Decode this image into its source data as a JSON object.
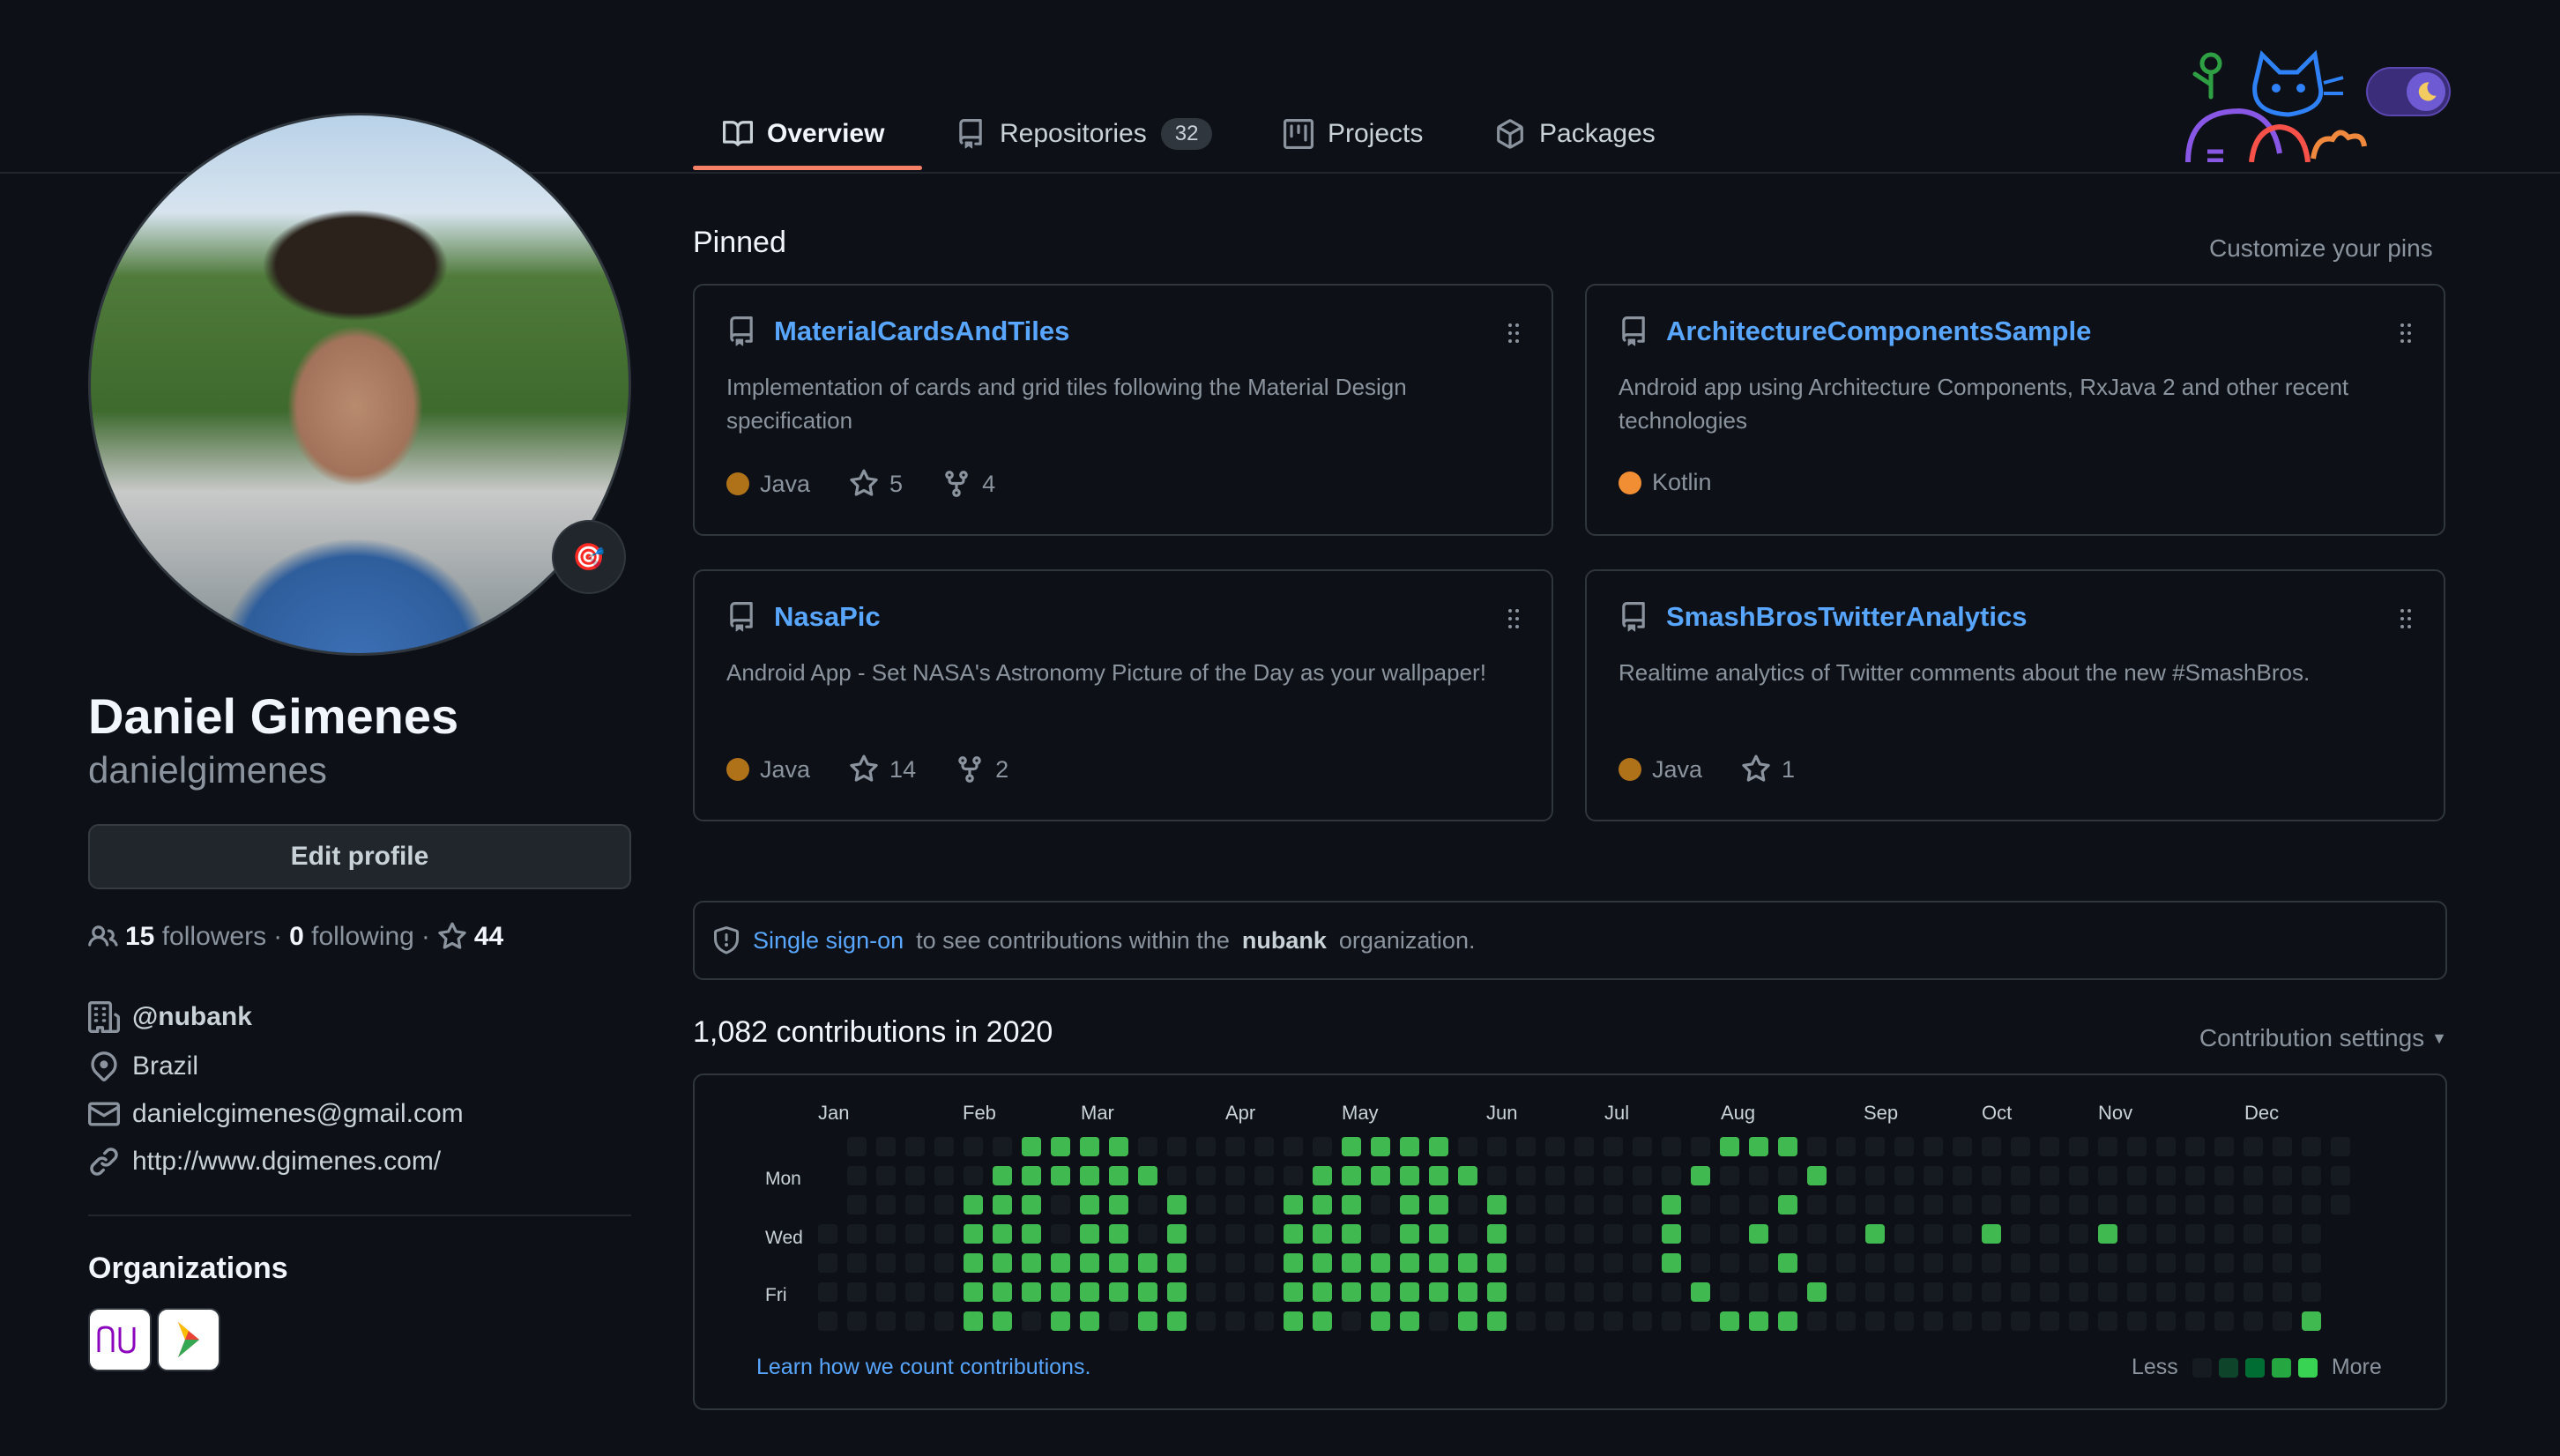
{
  "nav": {
    "tabs": [
      {
        "label": "Overview",
        "icon": "book-icon",
        "selected": true
      },
      {
        "label": "Repositories",
        "icon": "repo-icon",
        "count": "32"
      },
      {
        "label": "Projects",
        "icon": "project-icon"
      },
      {
        "label": "Packages",
        "icon": "package-icon"
      }
    ]
  },
  "profile": {
    "name": "Daniel Gimenes",
    "login": "danielgimenes",
    "edit_label": "Edit profile",
    "status_emoji": "🎯",
    "followers_count": "15",
    "followers_label": "followers",
    "following_count": "0",
    "following_label": "following",
    "stars_count": "44",
    "separator": "·",
    "company": "@nubank",
    "location": "Brazil",
    "email": "danielcgimenes@gmail.com",
    "website": "http://www.dgimenes.com/",
    "orgs_title": "Organizations"
  },
  "pinned": {
    "title": "Pinned",
    "customize_label": "Customize your pins",
    "items": [
      {
        "name": "MaterialCardsAndTiles",
        "description": "Implementation of cards and grid tiles following the Material Design specification",
        "language": "Java",
        "language_color": "#b07219",
        "stars": "5",
        "forks": "4"
      },
      {
        "name": "ArchitectureComponentsSample",
        "description": "Android app using Architecture Components, RxJava 2 and other recent technologies",
        "language": "Kotlin",
        "language_color": "#F18E33",
        "stars": "",
        "forks": ""
      },
      {
        "name": "NasaPic",
        "description": "Android App - Set NASA's Astronomy Picture of the Day as your wallpaper!",
        "language": "Java",
        "language_color": "#b07219",
        "stars": "14",
        "forks": "2"
      },
      {
        "name": "SmashBrosTwitterAnalytics",
        "description": "Realtime analytics of Twitter comments about the new #SmashBros.",
        "language": "Java",
        "language_color": "#b07219",
        "stars": "1",
        "forks": ""
      }
    ]
  },
  "sso": {
    "link": "Single sign-on",
    "text_before_org": "to see contributions within the",
    "org": "nubank",
    "text_after_org": "organization."
  },
  "contributions": {
    "title": "1,082 contributions in 2020",
    "settings_label": "Contribution settings",
    "months": [
      "Jan",
      "Feb",
      "Mar",
      "Apr",
      "May",
      "Jun",
      "Jul",
      "Aug",
      "Sep",
      "Oct",
      "Nov",
      "Dec"
    ],
    "days": [
      "Mon",
      "Wed",
      "Fri"
    ],
    "learn_label": "Learn how we count contributions.",
    "legend_less": "Less",
    "legend_more": "More",
    "colors": [
      "#161b22",
      "#0e4429",
      "#006d32",
      "#26a641",
      "#39d353"
    ],
    "active_color": "#3fb950"
  },
  "colors": {
    "accent": "#58a6ff",
    "tab_underline": "#f78166",
    "background": "#0d1117"
  }
}
